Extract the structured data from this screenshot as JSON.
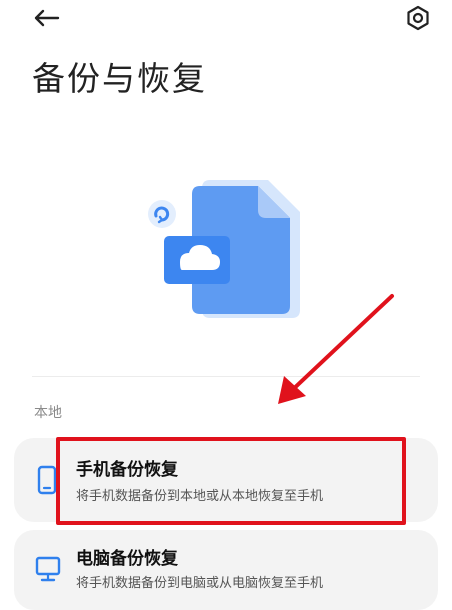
{
  "header": {
    "back_icon": "arrow-left-icon",
    "settings_icon": "gear-icon",
    "title": "备份与恢复"
  },
  "hero": {
    "icon": "cloud-backup-file-illustration",
    "colors": {
      "file": "#5e9bf2",
      "file_light": "#c9defb",
      "cloud_box": "#3d86f0",
      "sync": "#4a8ff3"
    }
  },
  "sections": {
    "local_label": "本地"
  },
  "items": [
    {
      "icon": "phone-icon",
      "title": "手机备份恢复",
      "subtitle": "将手机数据备份到本地或从本地恢复至手机"
    },
    {
      "icon": "monitor-icon",
      "title": "电脑备份恢复",
      "subtitle": "将手机数据备份到电脑或从电脑恢复至手机"
    }
  ],
  "annotation": {
    "color": "#e0121c",
    "type": "arrow-and-box"
  },
  "colors": {
    "accent": "#2f80ed",
    "card_bg": "#f3f3f3",
    "section_label": "#8a8a8a"
  }
}
